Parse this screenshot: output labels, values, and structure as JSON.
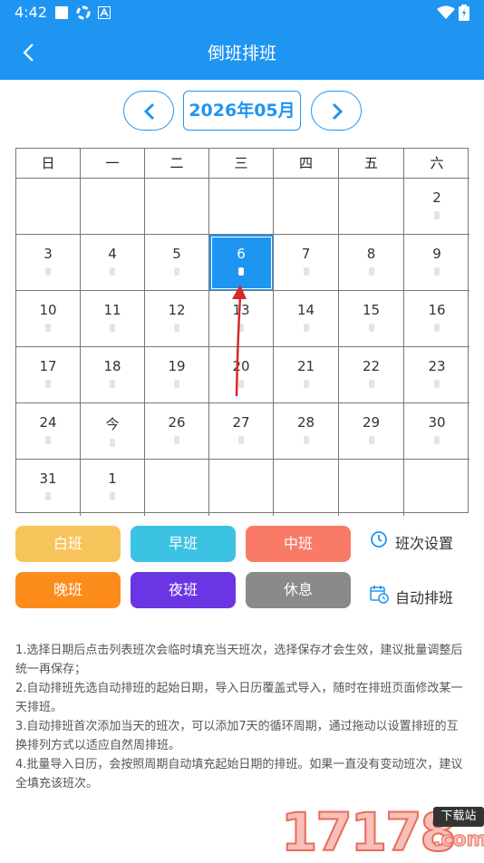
{
  "status_bar": {
    "time": "4:42"
  },
  "app_bar": {
    "title": "倒班排班"
  },
  "month_nav": {
    "month": "2026年05月"
  },
  "calendar": {
    "weekdays": [
      "日",
      "一",
      "二",
      "三",
      "四",
      "五",
      "六"
    ],
    "rows": [
      [
        "",
        "",
        "",
        "",
        "",
        "",
        "2"
      ],
      [
        "3",
        "4",
        "5",
        "6",
        "7",
        "8",
        "9"
      ],
      [
        "10",
        "11",
        "12",
        "13",
        "14",
        "15",
        "16"
      ],
      [
        "17",
        "18",
        "19",
        "20",
        "21",
        "22",
        "23"
      ],
      [
        "24",
        "今",
        "26",
        "27",
        "28",
        "29",
        "30"
      ],
      [
        "31",
        "1",
        "",
        "",
        "",
        "",
        ""
      ]
    ],
    "selected_day": "6"
  },
  "shifts": [
    {
      "label": "白班",
      "color": "#f7c45c"
    },
    {
      "label": "早班",
      "color": "#3cc2e3"
    },
    {
      "label": "中班",
      "color": "#fa7a68"
    },
    {
      "label": "晚班",
      "color": "#fb8c1c"
    },
    {
      "label": "夜班",
      "color": "#6a36e3"
    },
    {
      "label": "休息",
      "color": "#8a8a8a"
    }
  ],
  "actions": {
    "shift_settings": "班次设置",
    "auto_schedule": "自动排班"
  },
  "notes": [
    "1.选择日期后点击列表班次会临时填充当天班次，选择保存才会生效，建议批量调整后统一再保存；",
    "2.自动排班先选自动排班的起始日期，导入日历覆盖式导入，随时在排班页面修改某一天排班。",
    "3.自动排班首次添加当天的班次，可以添加7天的循环周期，通过拖动以设置排班的互换排列方式以适应自然周排班。",
    "4.批量导入日历，会按照周期自动填充起始日期的排班。如果一直没有变动班次，建议全填充该班次。"
  ],
  "watermark": {
    "digits": "17178",
    "badge": "下载站",
    "suffix": ".com"
  },
  "colors": {
    "primary": "#1f95f2",
    "grid_line": "#777777",
    "annotation_arrow": "#d42a2a"
  }
}
